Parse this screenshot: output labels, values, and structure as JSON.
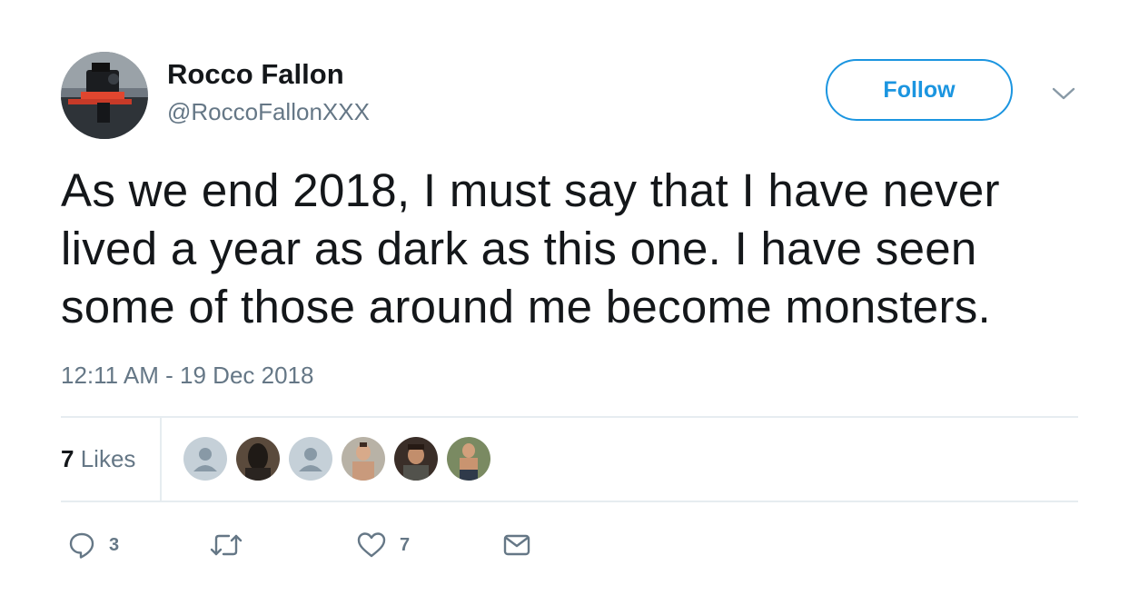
{
  "author": {
    "display_name": "Rocco Fallon",
    "handle": "@RoccoFallonXXX"
  },
  "follow_label": "Follow",
  "tweet": {
    "line1": "As we end 2018, I must say that I have never",
    "line2": "lived a year as dark as this one. I have seen",
    "line3": "some of those around me become monsters.",
    "timestamp": "12:11 AM - 19 Dec 2018"
  },
  "stats": {
    "likes_count": "7",
    "likes_label": "Likes"
  },
  "actions": {
    "reply_count": "3",
    "like_count": "7"
  },
  "colors": {
    "accent": "#1b95e0",
    "muted_text": "#657786",
    "divider": "#e6ecf0"
  }
}
